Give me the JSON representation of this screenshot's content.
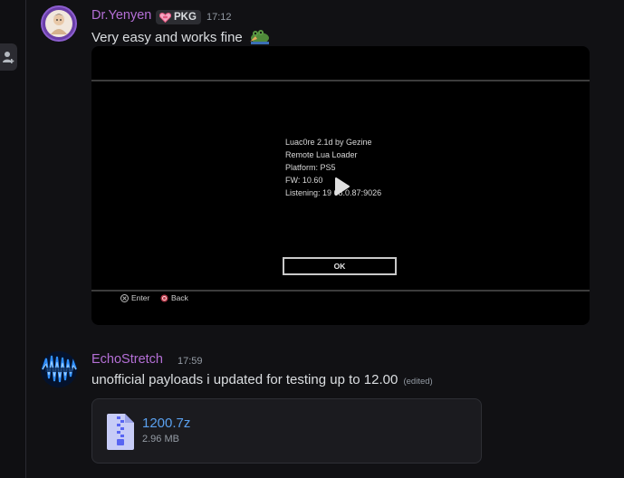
{
  "colors": {
    "background": "#111114",
    "name_purple": "#b46fd6",
    "link_blue": "#5aa0ee",
    "muted": "#949ba4"
  },
  "messages": [
    {
      "author": "Dr.Yenyen",
      "badge": "PKG",
      "badge_icon": "heart-icon",
      "time": "17:12",
      "text": "Very easy and works fine",
      "emoji": "frog-thumbsup-emoji",
      "video": {
        "lines": [
          "Luac0re 2.1d by Gezine",
          "Remote Lua Loader",
          "Platform: PS5",
          "FW: 10.60",
          "Listening: 19 68.0.87:9026"
        ],
        "ok_label": "OK",
        "enter_label": "Enter",
        "back_label": "Back"
      }
    },
    {
      "author": "EchoStretch",
      "time": "17:59",
      "text": "unofficial payloads i updated for testing up to 12.00",
      "edited": "(edited)",
      "attachment": {
        "filename": "1200.7z",
        "size": "2.96 MB",
        "icon": "zip-file-icon"
      }
    }
  ]
}
